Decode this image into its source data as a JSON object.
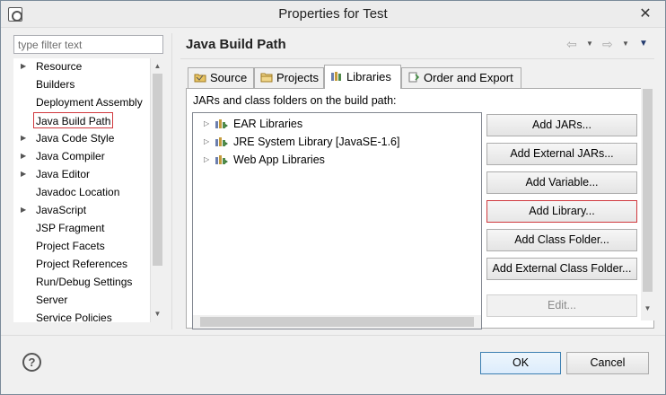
{
  "window": {
    "title": "Properties for Test",
    "close_glyph": "✕"
  },
  "filter": {
    "placeholder": "type filter text"
  },
  "left_tree": {
    "items": [
      {
        "label": "Resource",
        "expandable": true
      },
      {
        "label": "Builders",
        "expandable": false
      },
      {
        "label": "Deployment Assembly",
        "expandable": false
      },
      {
        "label": "Java Build Path",
        "expandable": false,
        "selected": true
      },
      {
        "label": "Java Code Style",
        "expandable": true
      },
      {
        "label": "Java Compiler",
        "expandable": true
      },
      {
        "label": "Java Editor",
        "expandable": true
      },
      {
        "label": "Javadoc Location",
        "expandable": false
      },
      {
        "label": "JavaScript",
        "expandable": true
      },
      {
        "label": "JSP Fragment",
        "expandable": false
      },
      {
        "label": "Project Facets",
        "expandable": false
      },
      {
        "label": "Project References",
        "expandable": false
      },
      {
        "label": "Run/Debug Settings",
        "expandable": false
      },
      {
        "label": "Server",
        "expandable": false
      },
      {
        "label": "Service Policies",
        "expandable": false
      }
    ]
  },
  "page": {
    "title": "Java Build Path"
  },
  "tabs": [
    {
      "label": "Source",
      "icon": "source-folder-icon"
    },
    {
      "label": "Projects",
      "icon": "projects-icon"
    },
    {
      "label": "Libraries",
      "icon": "libraries-icon",
      "active": true
    },
    {
      "label": "Order and Export",
      "icon": "order-export-icon"
    }
  ],
  "libraries_panel": {
    "description": "JARs and class folders on the build path:",
    "entries": [
      {
        "label": "EAR Libraries"
      },
      {
        "label": "JRE System Library [JavaSE-1.6]"
      },
      {
        "label": "Web App Libraries"
      }
    ],
    "buttons": [
      {
        "label": "Add JARs..."
      },
      {
        "label": "Add External JARs..."
      },
      {
        "label": "Add Variable..."
      },
      {
        "label": "Add Library...",
        "focused": true
      },
      {
        "label": "Add Class Folder..."
      },
      {
        "label": "Add External Class Folder..."
      },
      {
        "label": "Edit...",
        "disabled": true
      }
    ]
  },
  "footer": {
    "help": "?",
    "ok": "OK",
    "cancel": "Cancel"
  },
  "colors": {
    "selection_border": "#d0393e",
    "ok_border": "#3c7fb1"
  }
}
